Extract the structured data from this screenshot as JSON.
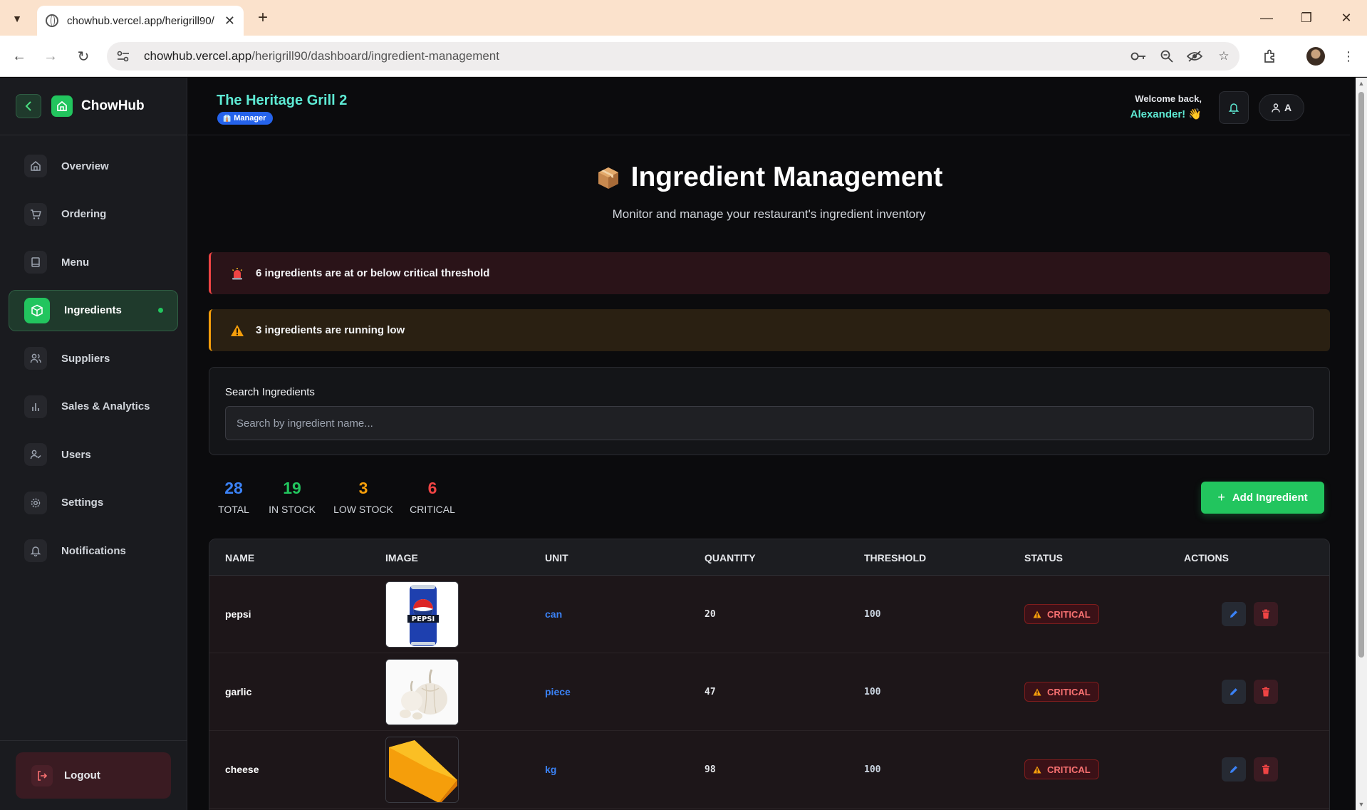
{
  "browser": {
    "tab_title": "chowhub.vercel.app/herigrill90/",
    "url_host": "chowhub.vercel.app",
    "url_path": "/herigrill90/dashboard/ingredient-management"
  },
  "sidebar": {
    "brand": "ChowHub",
    "items": [
      {
        "label": "Overview",
        "icon": "home-icon"
      },
      {
        "label": "Ordering",
        "icon": "cart-icon"
      },
      {
        "label": "Menu",
        "icon": "book-icon"
      },
      {
        "label": "Ingredients",
        "icon": "box-icon",
        "active": true
      },
      {
        "label": "Suppliers",
        "icon": "users-icon"
      },
      {
        "label": "Sales & Analytics",
        "icon": "bar-chart-icon"
      },
      {
        "label": "Users",
        "icon": "user-check-icon"
      },
      {
        "label": "Settings",
        "icon": "gear-icon"
      },
      {
        "label": "Notifications",
        "icon": "bell-icon"
      }
    ],
    "logout_label": "Logout"
  },
  "header": {
    "restaurant_name": "The Heritage Grill 2",
    "role": "Manager",
    "welcome_line": "Welcome back,",
    "user_name": "Alexander! 👋",
    "user_initial": "A"
  },
  "page": {
    "title": "Ingredient Management",
    "subtitle": "Monitor and manage your restaurant's ingredient inventory"
  },
  "alerts": {
    "critical": "6 ingredients are at or below critical threshold",
    "low": "3 ingredients are running low"
  },
  "search": {
    "label": "Search Ingredients",
    "placeholder": "Search by ingredient name...",
    "value": ""
  },
  "stats": [
    {
      "value": "28",
      "label": "TOTAL",
      "color": "#3b82f6"
    },
    {
      "value": "19",
      "label": "IN STOCK",
      "color": "#22c55e"
    },
    {
      "value": "3",
      "label": "LOW STOCK",
      "color": "#f59e0b"
    },
    {
      "value": "6",
      "label": "CRITICAL",
      "color": "#ef4444"
    }
  ],
  "add_button_label": "Add Ingredient",
  "table": {
    "columns": [
      "NAME",
      "IMAGE",
      "UNIT",
      "QUANTITY",
      "THRESHOLD",
      "STATUS",
      "ACTIONS"
    ],
    "rows": [
      {
        "name": "pepsi",
        "image": "pepsi-can",
        "unit": "can",
        "quantity": "20",
        "threshold": "100",
        "status": "CRITICAL"
      },
      {
        "name": "garlic",
        "image": "garlic-bulbs",
        "unit": "piece",
        "quantity": "47",
        "threshold": "100",
        "status": "CRITICAL"
      },
      {
        "name": "cheese",
        "image": "cheese-wedge",
        "unit": "kg",
        "quantity": "98",
        "threshold": "100",
        "status": "CRITICAL"
      }
    ]
  },
  "colors": {
    "accent_green": "#22c55e",
    "accent_teal": "#5eead4",
    "critical_red": "#ef4444",
    "warning_amber": "#f59e0b",
    "link_blue": "#3b82f6"
  }
}
